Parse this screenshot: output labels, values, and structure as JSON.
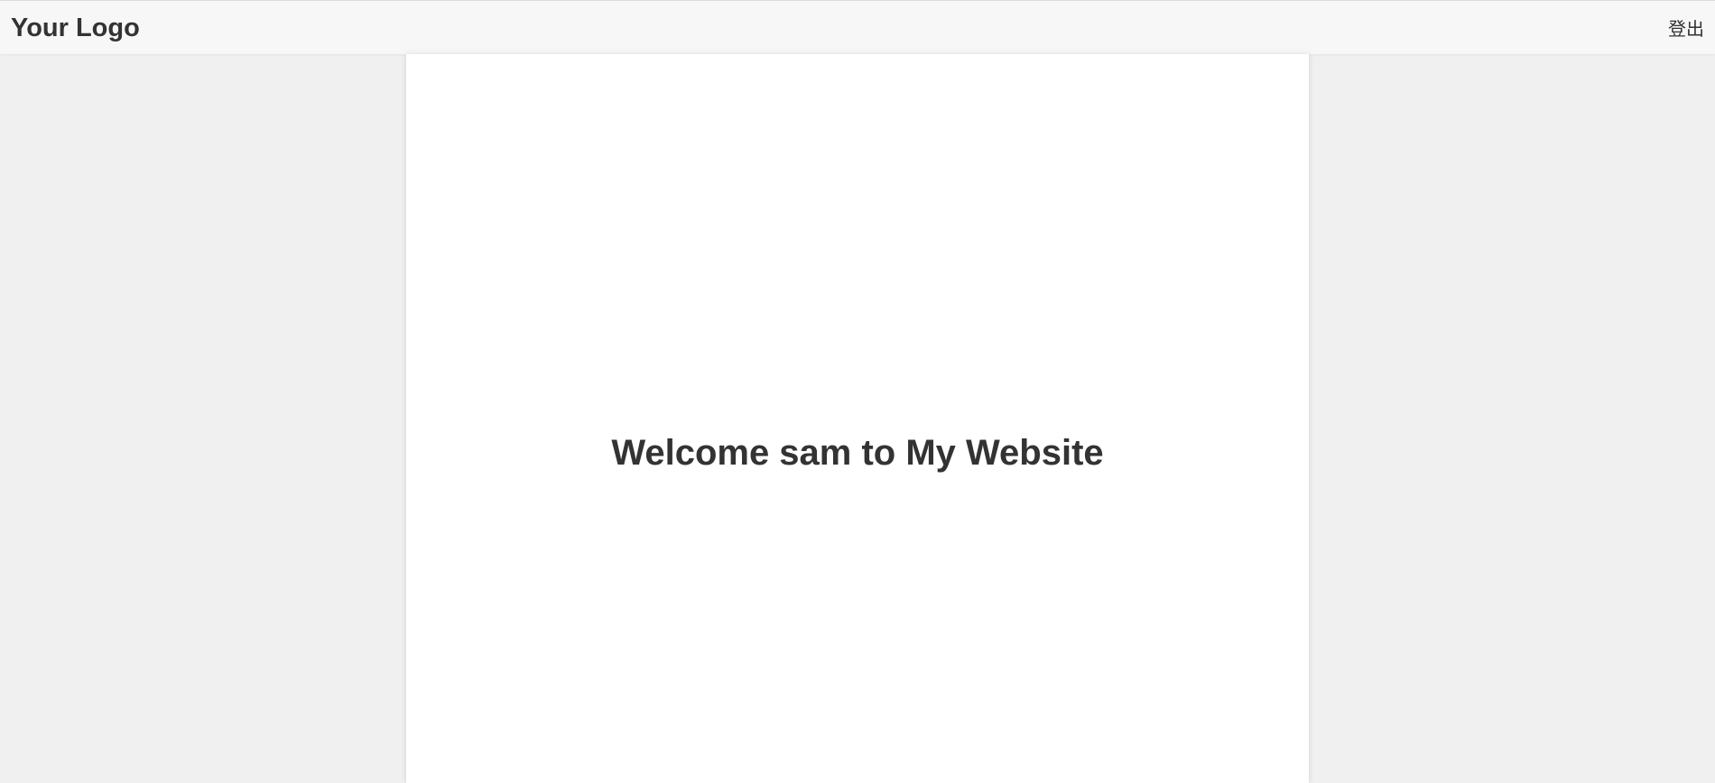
{
  "header": {
    "logo_text": "Your Logo",
    "logout_label": "登出"
  },
  "main": {
    "welcome_heading": "Welcome sam to My Website"
  },
  "colors": {
    "page_background": "#f0f0f0",
    "header_background": "#f7f7f7",
    "panel_background": "#ffffff",
    "text": "#333333"
  }
}
